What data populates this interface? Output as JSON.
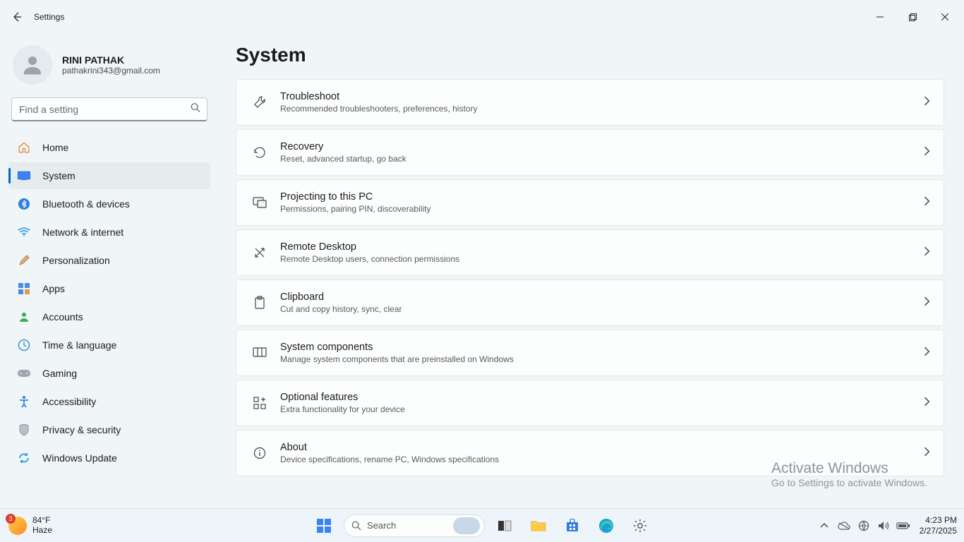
{
  "window": {
    "title": "Settings"
  },
  "user": {
    "name": "RINI PATHAK",
    "email": "pathakrini343@gmail.com"
  },
  "search": {
    "placeholder": "Find a setting"
  },
  "nav": {
    "items": [
      {
        "label": "Home"
      },
      {
        "label": "System"
      },
      {
        "label": "Bluetooth & devices"
      },
      {
        "label": "Network & internet"
      },
      {
        "label": "Personalization"
      },
      {
        "label": "Apps"
      },
      {
        "label": "Accounts"
      },
      {
        "label": "Time & language"
      },
      {
        "label": "Gaming"
      },
      {
        "label": "Accessibility"
      },
      {
        "label": "Privacy & security"
      },
      {
        "label": "Windows Update"
      }
    ]
  },
  "page": {
    "title": "System"
  },
  "cards": [
    {
      "title": "Troubleshoot",
      "sub": "Recommended troubleshooters, preferences, history"
    },
    {
      "title": "Recovery",
      "sub": "Reset, advanced startup, go back"
    },
    {
      "title": "Projecting to this PC",
      "sub": "Permissions, pairing PIN, discoverability"
    },
    {
      "title": "Remote Desktop",
      "sub": "Remote Desktop users, connection permissions"
    },
    {
      "title": "Clipboard",
      "sub": "Cut and copy history, sync, clear"
    },
    {
      "title": "System components",
      "sub": "Manage system components that are preinstalled on Windows"
    },
    {
      "title": "Optional features",
      "sub": "Extra functionality for your device"
    },
    {
      "title": "About",
      "sub": "Device specifications, rename PC, Windows specifications"
    }
  ],
  "watermark": {
    "title": "Activate Windows",
    "sub": "Go to Settings to activate Windows."
  },
  "taskbar": {
    "weather": {
      "badge": "3",
      "temp": "84°F",
      "cond": "Haze"
    },
    "search": "Search",
    "time": "4:23 PM",
    "date": "2/27/2025"
  }
}
